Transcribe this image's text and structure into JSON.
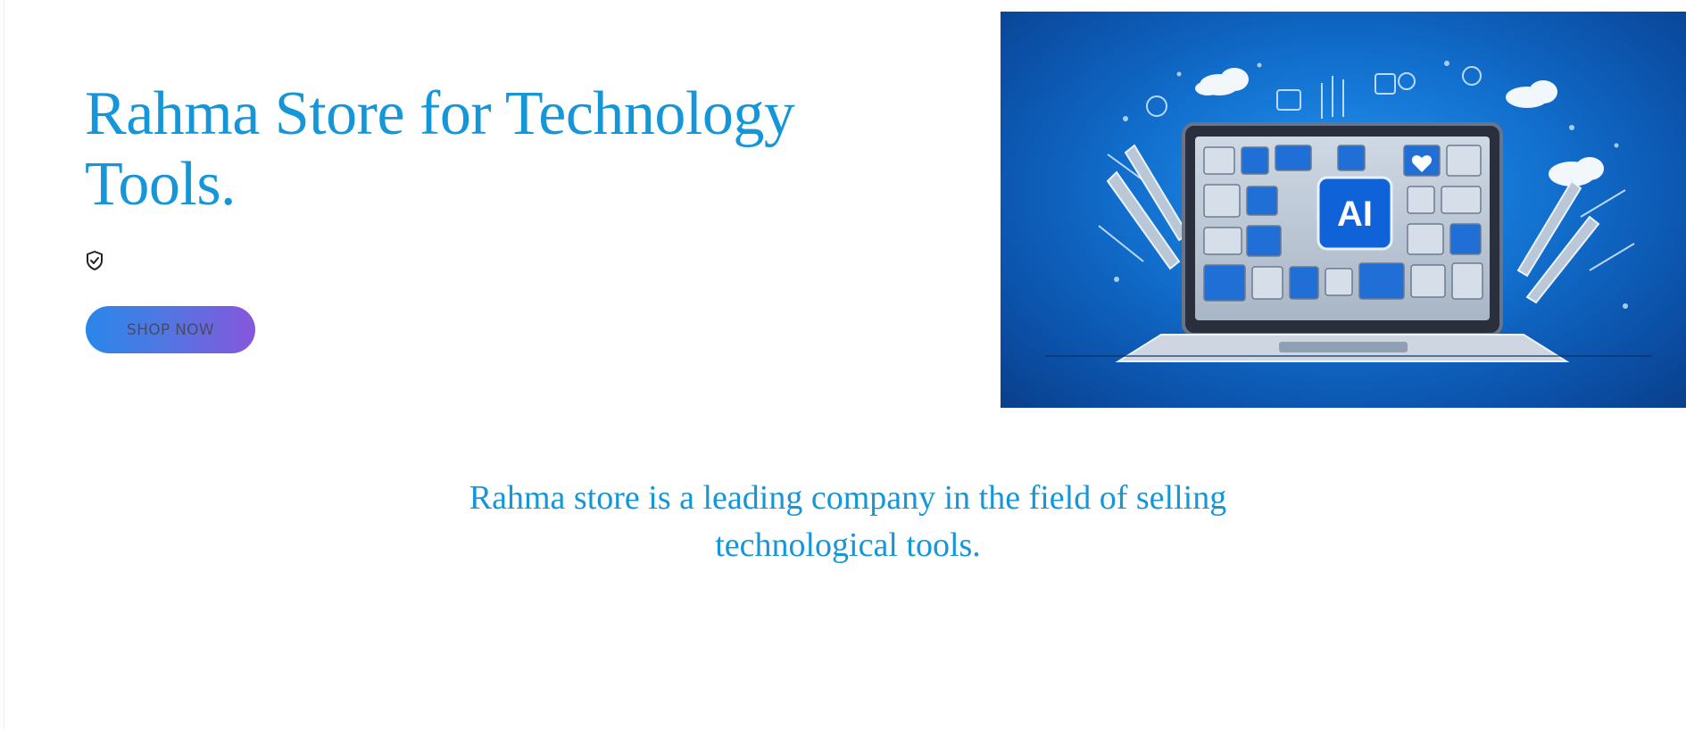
{
  "hero": {
    "title": "Rahma Store for Technology Tools.",
    "badge_icon": "shield-check-icon",
    "shop_button_label": "SHOP NOW"
  },
  "illustration": {
    "center_label": "AI"
  },
  "about": {
    "tagline": "Rahma store is a leading company in the field of selling technological tools."
  },
  "colors": {
    "accent": "#1596d8",
    "button_gradient_start": "#2a86ea",
    "button_gradient_end": "#8656dc",
    "illustration_background": "#0f6fd1"
  }
}
